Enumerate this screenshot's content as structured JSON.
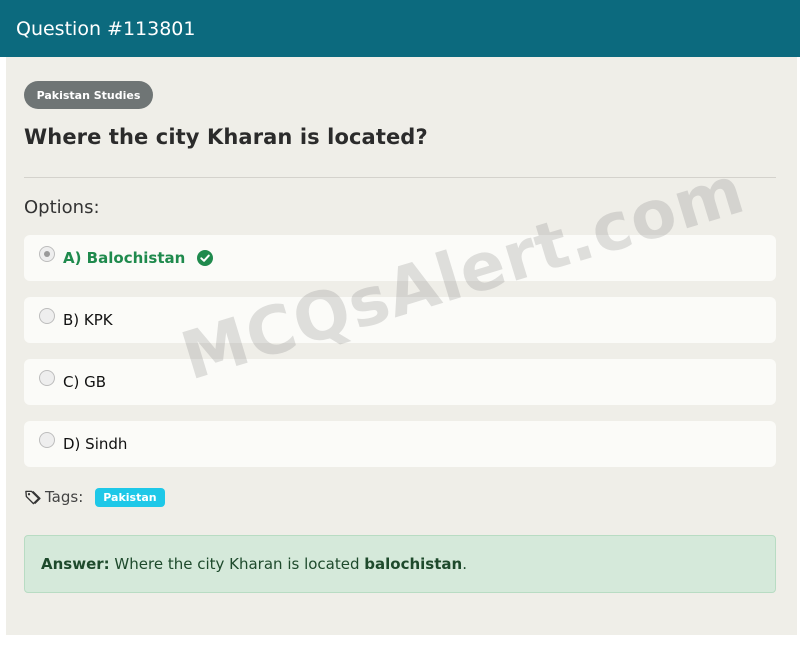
{
  "header": {
    "title": "Question #113801"
  },
  "question": {
    "category": "Pakistan Studies",
    "text": "Where the city Kharan is located?",
    "options_label": "Options:",
    "options": [
      {
        "label": "A) Balochistan",
        "selected": true,
        "correct": true
      },
      {
        "label": "B) KPK",
        "selected": false,
        "correct": false
      },
      {
        "label": "C) GB",
        "selected": false,
        "correct": false
      },
      {
        "label": "D) Sindh",
        "selected": false,
        "correct": false
      }
    ]
  },
  "tags": {
    "label": "Tags:",
    "items": [
      "Pakistan"
    ]
  },
  "answer": {
    "prefix": "Answer:",
    "text": " Where the city Kharan is located ",
    "value": "balochistan",
    "suffix": "."
  },
  "watermark": "MCQsAlert.com",
  "colors": {
    "header_bg": "#0c6a7e",
    "card_bg": "#efeee8",
    "correct_green": "#1f8a4d",
    "tag_pill": "#1ec8e8",
    "answer_bg": "#d5e9da"
  },
  "icons": {
    "correct": "check-circle-icon",
    "tag": "tag-icon"
  }
}
